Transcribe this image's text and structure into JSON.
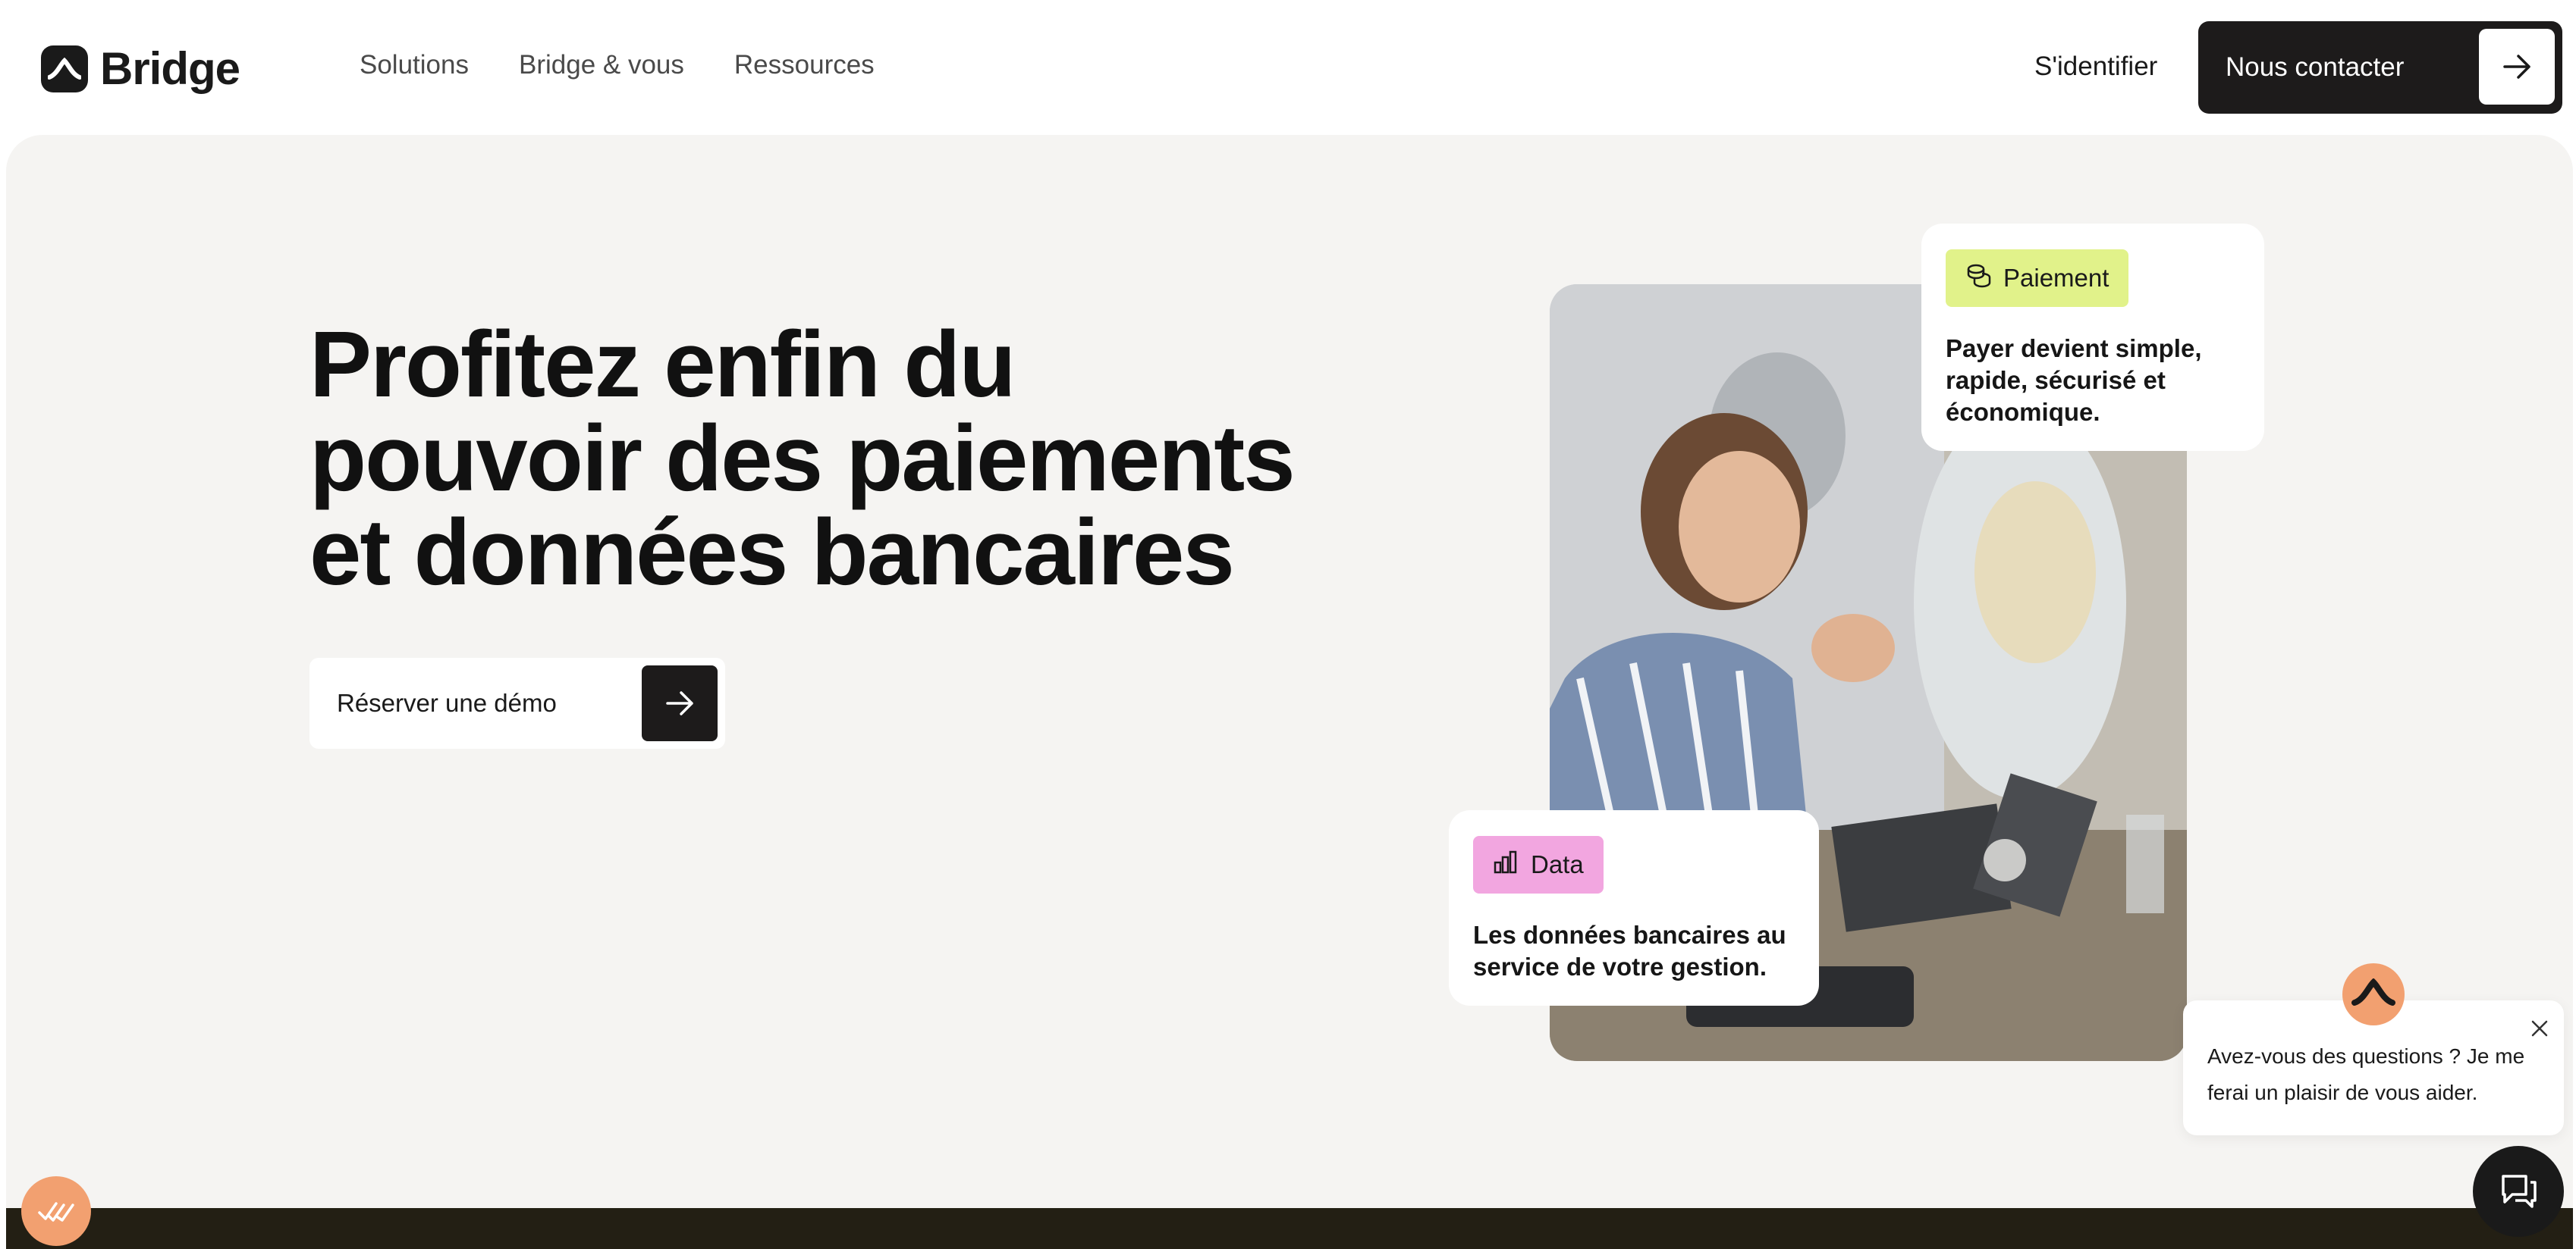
{
  "header": {
    "logo_text": "Bridge",
    "logo_icon": "bridge-logo-icon",
    "nav": [
      {
        "label": "Solutions"
      },
      {
        "label": "Bridge & vous"
      },
      {
        "label": "Ressources"
      }
    ],
    "signin_label": "S'identifier",
    "contact_label": "Nous contacter",
    "contact_icon": "arrow-right-icon"
  },
  "hero": {
    "headline_lines": [
      "Profitez enfin du",
      "pouvoir des paiements",
      "et données bancaires"
    ],
    "demo_label": "Réserver une démo",
    "demo_icon": "arrow-right-icon"
  },
  "cards": {
    "payment": {
      "pill_label": "Paiement",
      "pill_icon": "coins-icon",
      "pill_color": "#e1f28a",
      "text": "Payer devient simple, rapide, sécurisé et économique."
    },
    "data": {
      "pill_label": "Data",
      "pill_icon": "bar-chart-icon",
      "pill_color": "#f2a6e0",
      "text": "Les données bancaires au service de votre gestion."
    }
  },
  "chat": {
    "message": "Avez-vous des questions ? Je me ferai un plaisir de vous aider.",
    "avatar_icon": "bridge-logo-icon",
    "close_icon": "close-icon",
    "launcher_icon": "chat-icon"
  },
  "colors": {
    "dark": "#1d1b1b",
    "hero_bg": "#f5f4f2",
    "accent_orange": "#f2a070",
    "footer": "#231f14"
  }
}
